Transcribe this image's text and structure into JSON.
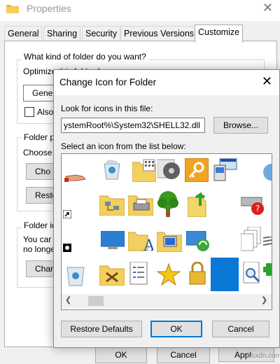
{
  "properties": {
    "title": "Properties",
    "tabs": [
      "General",
      "Sharing",
      "Security",
      "Previous Versions",
      "Customize"
    ],
    "active_tab": "Customize",
    "customize": {
      "q_folder_kind": "What kind of folder do you want?",
      "optimize_label": "Optimize this folder for:",
      "optimize_value": "Gene",
      "also_apply": "Also",
      "folder_pictures": "Folder p",
      "choose": "Choose",
      "choose_btn": "Cho",
      "restore_btn": "Resto",
      "folder_icons": "Folder ic",
      "you_can": "You car",
      "no_longer": "no longe",
      "change_btn": "Chan"
    },
    "footer": {
      "ok": "OK",
      "cancel": "Cancel",
      "apply": "Appl"
    }
  },
  "dialog": {
    "title": "Change Icon for  Folder",
    "look_label": "Look for icons in this file:",
    "path_value": "ystemRoot%\\System32\\SHELL32.dll",
    "browse": "Browse...",
    "select_label": "Select an icon from the list below:",
    "restore_defaults": "Restore Defaults",
    "ok": "OK",
    "cancel": "Cancel"
  },
  "icons": [
    "hand-share-icon",
    "recycle-bin-full-icon",
    "folder-grid-icon",
    "media-disc-icon",
    "key-icon",
    "control-panel-icon",
    "folder-network-icon",
    "folder-printer-icon",
    "tree-icon",
    "file-up-arrow-icon",
    "printer-error-icon",
    "shortcut-arrow-icon",
    "desktop-monitor-icon",
    "folder-font-icon",
    "computer-folder-icon",
    "network-sync-icon",
    "documents-stack-icon",
    "recycle-bin-icon",
    "folder-tools-icon",
    "checklist-icon",
    "star-icon",
    "padlock-icon",
    "blue-tile-icon",
    "search-document-icon",
    "green-plus-icon"
  ],
  "watermark": "wsxdn.com",
  "colors": {
    "accent": "#0078d7",
    "selected_tile": "#0a78d7"
  }
}
